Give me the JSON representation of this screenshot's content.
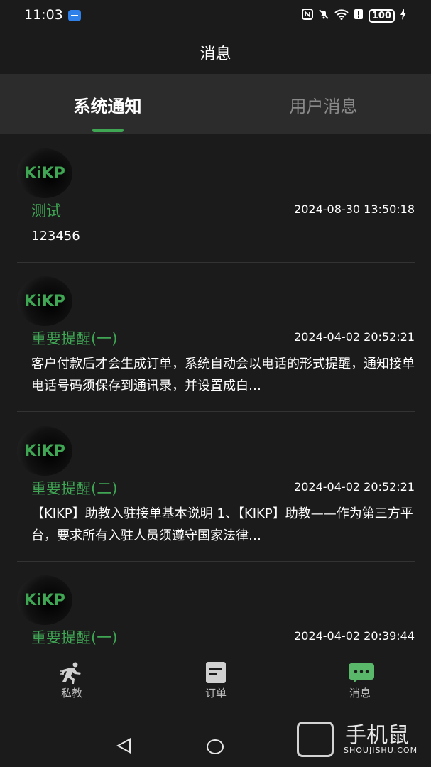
{
  "status_bar": {
    "time": "11:03",
    "battery": "100",
    "icons": [
      "nfc-icon",
      "mute-icon",
      "wifi-icon",
      "alert-icon",
      "battery-icon",
      "charging-icon"
    ]
  },
  "header": {
    "title": "消息"
  },
  "tabs": [
    {
      "label": "系统通知",
      "active": true
    },
    {
      "label": "用户消息",
      "active": false
    }
  ],
  "messages": [
    {
      "avatar": "KiKP",
      "title": "测试",
      "time": "2024-08-30 13:50:18",
      "body": "123456"
    },
    {
      "avatar": "KiKP",
      "title": "重要提醒(一)",
      "time": "2024-04-02 20:52:21",
      "body": "客户付款后才会生成订单，系统自动会以电话的形式提醒，通知接单电话号码须保存到通讯录，并设置成白…"
    },
    {
      "avatar": "KiKP",
      "title": "重要提醒(二)",
      "time": "2024-04-02 20:52:21",
      "body": "【KIKP】助教入驻接单基本说明 1、【KIKP】助教——作为第三方平台，要求所有入驻人员须遵守国家法律…"
    },
    {
      "avatar": "KiKP",
      "title": "重要提醒(一)",
      "time": "2024-04-02 20:39:44",
      "body": ""
    }
  ],
  "bottom_nav": [
    {
      "label": "私教",
      "icon": "runner-icon"
    },
    {
      "label": "订单",
      "icon": "order-icon"
    },
    {
      "label": "消息",
      "icon": "chat-icon",
      "active": true
    }
  ],
  "watermark": {
    "text": "手机鼠",
    "sub": "SHOUJISHU.COM"
  },
  "colors": {
    "accent": "#3fa654",
    "background": "#1b1b1b",
    "tabbar": "#2c2c2c"
  }
}
